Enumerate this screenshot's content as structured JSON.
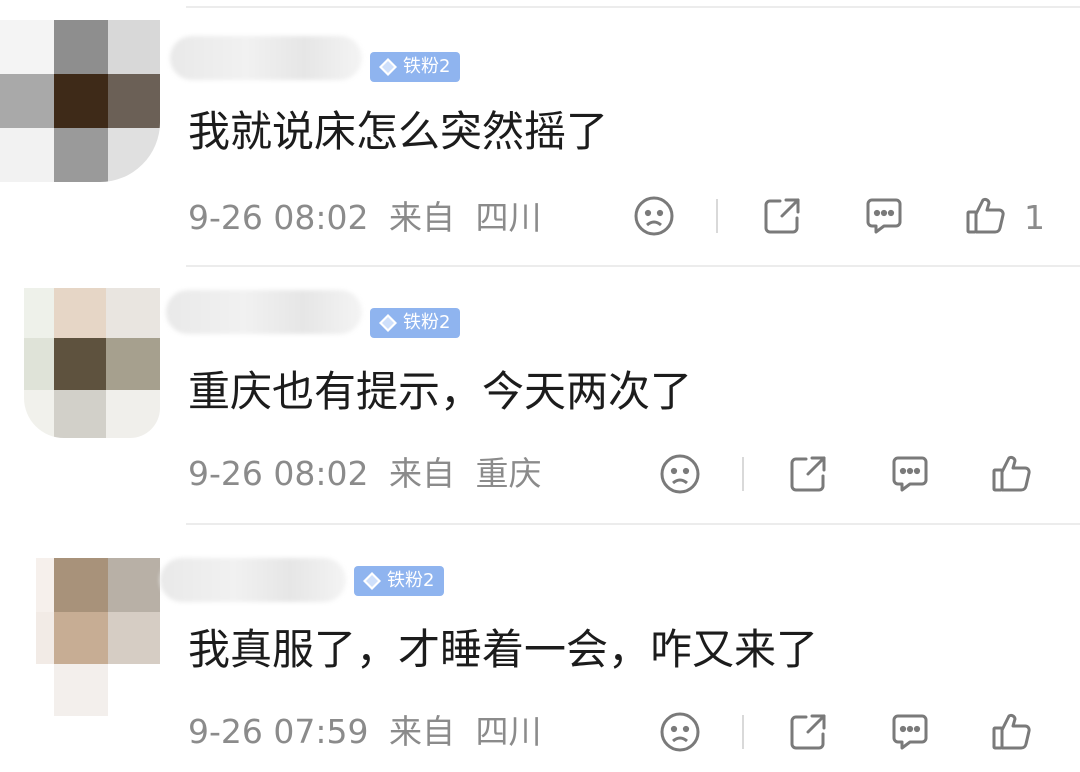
{
  "comments": [
    {
      "badge": "铁粉2",
      "text": "我就说床怎么突然摇了",
      "time": "9-26 08:02",
      "from_label": "来自",
      "location": "四川",
      "like_count": "1"
    },
    {
      "badge": "铁粉2",
      "text": "重庆也有提示，今天两次了",
      "time": "9-26 08:02",
      "from_label": "来自",
      "location": "重庆",
      "like_count": ""
    },
    {
      "badge": "铁粉2",
      "text": "我真服了，才睡着一会，咋又来了",
      "time": "9-26 07:59",
      "from_label": "来自",
      "location": "四川",
      "like_count": ""
    }
  ],
  "icons": {
    "sad": "sad-face-icon",
    "share": "share-icon",
    "reply": "comment-icon",
    "like": "thumbs-up-icon"
  },
  "colors": {
    "badge_bg": "#8fb4ef",
    "text": "#1c1c1c",
    "meta": "#8b8b8b"
  }
}
